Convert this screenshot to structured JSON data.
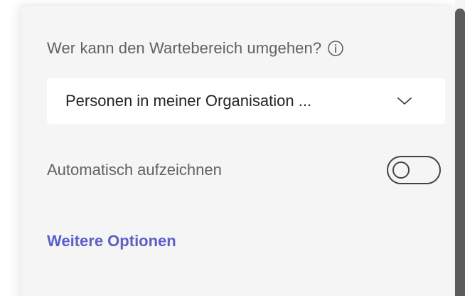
{
  "lobby": {
    "bypass_question": "Wer kann den Wartebereich umgehen?",
    "info_icon": "info-icon",
    "bypass_selected": "Personen in meiner Organisation ...",
    "dropdown_icon": "chevron-down-icon"
  },
  "recording": {
    "label": "Automatisch aufzeichnen",
    "enabled": false
  },
  "links": {
    "more_options": "Weitere Optionen"
  },
  "colors": {
    "panel_bg": "#f5f5f5",
    "link_accent": "#5b5fc7",
    "label_text": "#616161",
    "value_text": "#242424"
  }
}
